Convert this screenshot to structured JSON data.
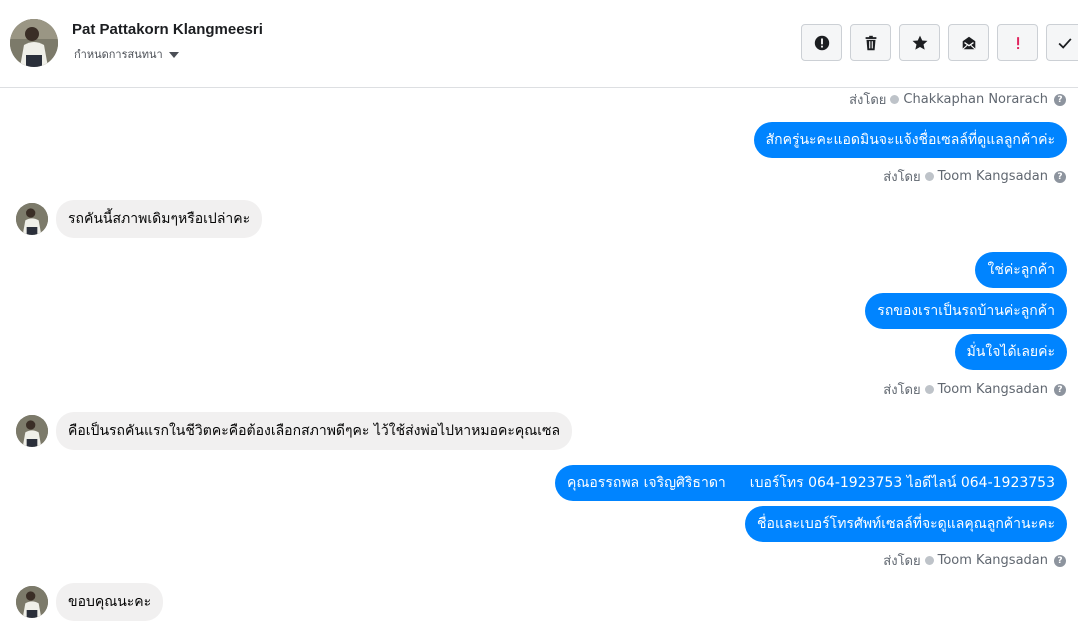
{
  "header": {
    "name": "Pat Pattakorn Klangmeesri",
    "subtitle": "กำหนดการสนทนา",
    "actions": [
      {
        "icon": "report-icon"
      },
      {
        "icon": "trash-icon"
      },
      {
        "icon": "star-icon"
      },
      {
        "icon": "mark-unread-icon"
      },
      {
        "icon": "important-icon"
      },
      {
        "icon": "check-icon"
      }
    ]
  },
  "sent_by_label": "ส่งโดย",
  "messages": {
    "top_sender": "Chakkaphan Norarach",
    "out1": "สักครู่นะคะแอดมินจะแจ้งชื่อเซลล์ที่ดูแลลูกค้าค่ะ",
    "sender1": "Toom Kangsadan",
    "in1": "รถคันนี้สภาพเดิมๆหรือเปล่าคะ",
    "out2": "ใช่ค่ะลูกค้า",
    "out3": "รถของเราเป็นรถบ้านค่ะลูกค้า",
    "out4": "มั่นใจได้เลยค่ะ",
    "sender2": "Toom Kangsadan",
    "in2": "คือเป็นรถคันแรกในชีวิตคะคือต้องเลือกสภาพดีๆคะ ไว้ใช้ส่งพ่อไปหาหมอคะคุณเซล",
    "out5_name": "คุณอรรถพล เจริญศิริธาดา",
    "out5_phone": "เบอร์โทร 064-1923753 ไอดีไลน์ 064-1923753",
    "out6": "ชื่อและเบอร์โทรศัพท์เซลล์ที่จะดูแลคุณลูกค้านะคะ",
    "sender3": "Toom Kangsadan",
    "in3": "ขอบคุณนะคะ"
  },
  "colors": {
    "outgoing_bubble": "#0084ff",
    "incoming_bubble": "#f1f0f0",
    "important_icon": "#e0245e"
  }
}
